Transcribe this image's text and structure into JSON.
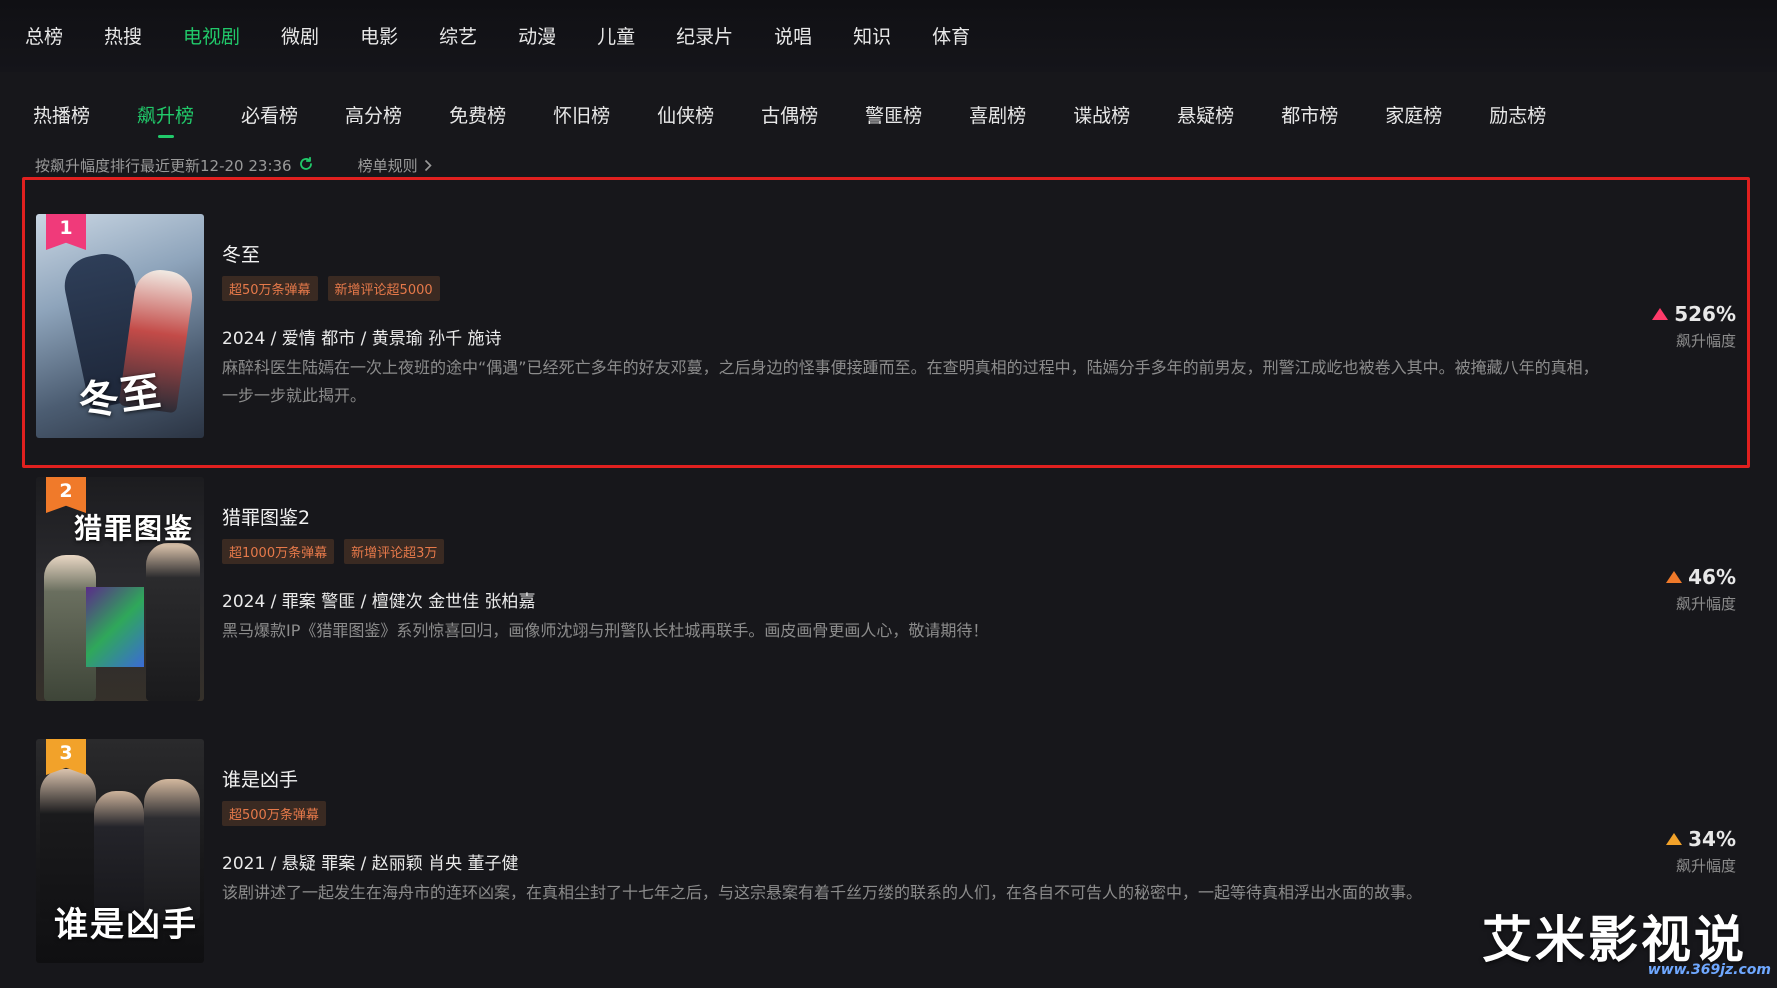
{
  "nav_primary": {
    "items": [
      "总榜",
      "热搜",
      "电视剧",
      "微剧",
      "电影",
      "综艺",
      "动漫",
      "儿童",
      "纪录片",
      "说唱",
      "知识",
      "体育"
    ],
    "active_index": 2
  },
  "nav_secondary": {
    "items": [
      "热播榜",
      "飙升榜",
      "必看榜",
      "高分榜",
      "免费榜",
      "怀旧榜",
      "仙侠榜",
      "古偶榜",
      "警匪榜",
      "喜剧榜",
      "谍战榜",
      "悬疑榜",
      "都市榜",
      "家庭榜",
      "励志榜"
    ],
    "active_index": 1
  },
  "subinfo": {
    "sort_text": "按飙升幅度排行最近更新12-20 23:36",
    "rules_label": "榜单规则"
  },
  "colors": {
    "accent": "#21c96a",
    "highlight_border": "#e0201f",
    "tag_text": "#e6794a",
    "rank1": "#f03a7a",
    "rank2": "#f07a2a",
    "rank3": "#f2a22a"
  },
  "list": [
    {
      "rank": "1",
      "title": "冬至",
      "poster_text": "冬至",
      "tags": [
        "超50万条弹幕",
        "新增评论超5000"
      ],
      "meta": "2024 / 爱情 都市 / 黄景瑜 孙千 施诗",
      "desc": "麻醉科医生陆嫣在一次上夜班的途中“偶遇”已经死亡多年的好友邓蔓，之后身边的怪事便接踵而至。在查明真相的过程中，陆嫣分手多年的前男友，刑警江成屹也被卷入其中。被掩藏八年的真相，一步一步就此揭开。",
      "growth": "526%",
      "growth_label": "飙升幅度"
    },
    {
      "rank": "2",
      "title": "猎罪图鉴2",
      "poster_text": "猎罪图鉴",
      "tags": [
        "超1000万条弹幕",
        "新增评论超3万"
      ],
      "meta": "2024 / 罪案 警匪 / 檀健次 金世佳 张柏嘉",
      "desc": "黑马爆款IP《猎罪图鉴》系列惊喜回归，画像师沈翊与刑警队长杜城再联手。画皮画骨更画人心，敬请期待！",
      "growth": "46%",
      "growth_label": "飙升幅度"
    },
    {
      "rank": "3",
      "title": "谁是凶手",
      "poster_text": "谁是凶手",
      "tags": [
        "超500万条弹幕"
      ],
      "meta": "2021 / 悬疑 罪案 / 赵丽颖 肖央 董子健",
      "desc": "该剧讲述了一起发生在海舟市的连环凶案，在真相尘封了十七年之后，与这宗悬案有着千丝万缕的联系的人们，在各自不可告人的秘密中，一起等待真相浮出水面的故事。",
      "growth": "34%",
      "growth_label": "飙升幅度"
    }
  ],
  "watermark": {
    "text": "艾米影视说",
    "url": "www.369jz.com"
  }
}
